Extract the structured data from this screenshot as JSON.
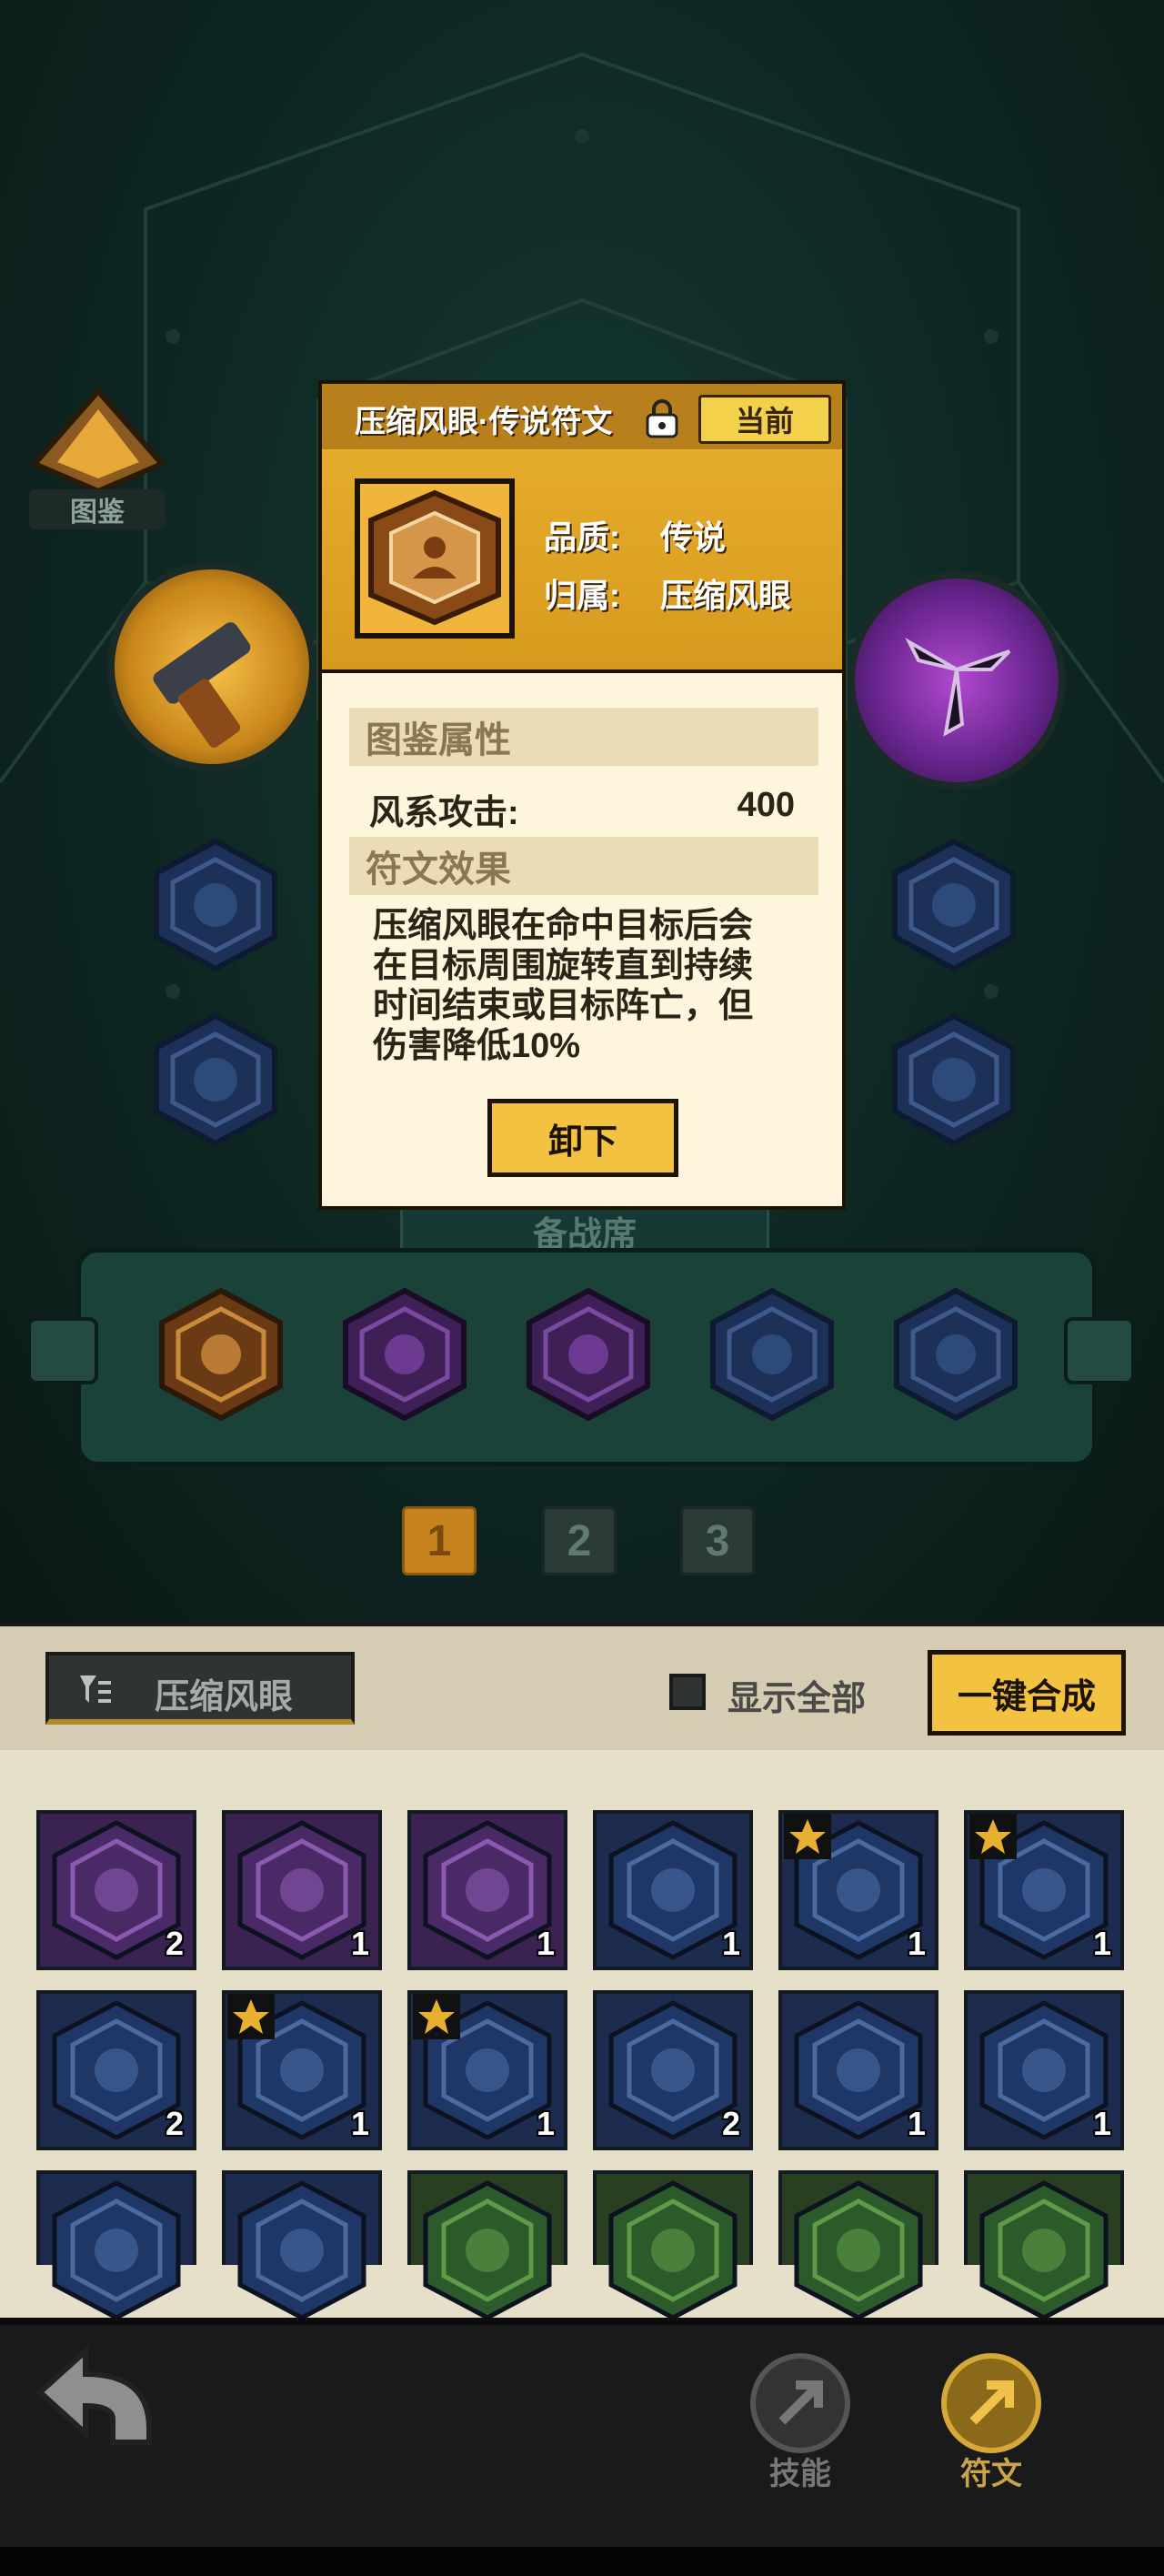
{
  "atlas": {
    "label": "图鉴"
  },
  "bench": {
    "label": "备战席"
  },
  "pagination": {
    "pages": [
      "1",
      "2",
      "3"
    ],
    "active": "1"
  },
  "popup": {
    "title": "压缩风眼·传说符文",
    "current_badge": "当前",
    "quality_label": "品质:",
    "quality_value": "传说",
    "belongs_label": "归属:",
    "belongs_value": "压缩风眼",
    "attr_section_title": "图鉴属性",
    "attr_name": "风系攻击:",
    "attr_value": "400",
    "effect_section_title": "符文效果",
    "effect_lines": [
      "压缩风眼在命中目标后会",
      "在目标周围旋转直到持续",
      "时间结束或目标阵亡，但",
      "伤害降低10%"
    ],
    "unequip_button": "卸下"
  },
  "filter": {
    "label": "压缩风眼",
    "show_all_label": "显示全部",
    "show_all_checked": false,
    "merge_button": "一键合成"
  },
  "inventory": {
    "row1": [
      {
        "icon": "tornado-rune-icon",
        "count": "2",
        "color": "purple",
        "star": false
      },
      {
        "icon": "meditate-rune-icon",
        "count": "1",
        "color": "purple",
        "star": false
      },
      {
        "icon": "vortex-rune-icon",
        "count": "1",
        "color": "purple",
        "star": false
      },
      {
        "icon": "tornado-rune-icon",
        "count": "1",
        "color": "blue",
        "star": false
      },
      {
        "icon": "fist-rune-icon",
        "count": "1",
        "color": "blue",
        "star": true
      },
      {
        "icon": "fist-up-rune-icon",
        "count": "1",
        "color": "blue",
        "star": true
      }
    ],
    "row2": [
      {
        "icon": "chevron-rune-icon",
        "count": "2",
        "color": "blue",
        "star": false
      },
      {
        "icon": "fist-ring-rune-icon",
        "count": "1",
        "color": "blue",
        "star": true
      },
      {
        "icon": "fist-ring-rune-icon",
        "count": "1",
        "color": "blue",
        "star": true
      },
      {
        "icon": "burst-rune-icon",
        "count": "2",
        "color": "blue",
        "star": false
      },
      {
        "icon": "fist-rune-icon",
        "count": "1",
        "color": "blue",
        "star": false
      },
      {
        "icon": "fist-up-rune-icon",
        "count": "1",
        "color": "blue",
        "star": false
      }
    ],
    "row3": [
      {
        "icon": "fist-rune-icon",
        "color": "blue"
      },
      {
        "icon": "shield-rune-icon",
        "color": "blue"
      },
      {
        "icon": "fist-rune-icon",
        "color": "green"
      },
      {
        "icon": "fist-rune-icon",
        "color": "green"
      },
      {
        "icon": "fist-rune-icon",
        "color": "green"
      },
      {
        "icon": "fist-rune-icon",
        "color": "green"
      }
    ]
  },
  "nav": {
    "back_icon": "back-arrow-icon",
    "skills_label": "技能",
    "runes_label": "符文"
  },
  "colors": {
    "gold": "#e8b030",
    "purple": "#5a2f7a",
    "blue": "#23376a",
    "green": "#2f5a2e"
  }
}
